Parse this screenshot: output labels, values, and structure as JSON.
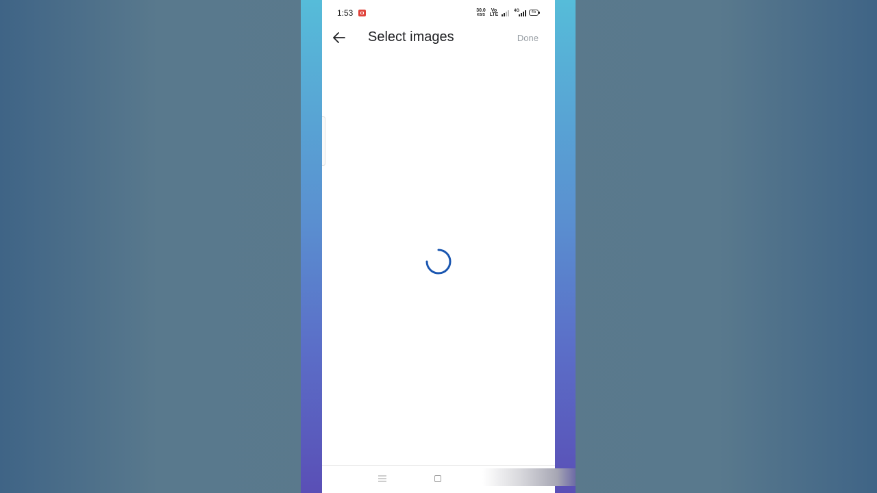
{
  "status_bar": {
    "time": "1:53",
    "net_speed_value": "30.0",
    "net_speed_unit": "KB/S",
    "volte_top": "Vo",
    "volte_bottom": "LTE",
    "network_type": "4G",
    "battery_level": "45"
  },
  "app_bar": {
    "title": "Select images",
    "done_label": "Done"
  },
  "loading": {
    "spinner_color": "#1a56b0"
  },
  "colors": {
    "frame_gradient_top": "#56bcd9",
    "frame_gradient_bottom": "#5a4fb6",
    "title_text": "#202124",
    "done_text": "#9aa0a6"
  }
}
